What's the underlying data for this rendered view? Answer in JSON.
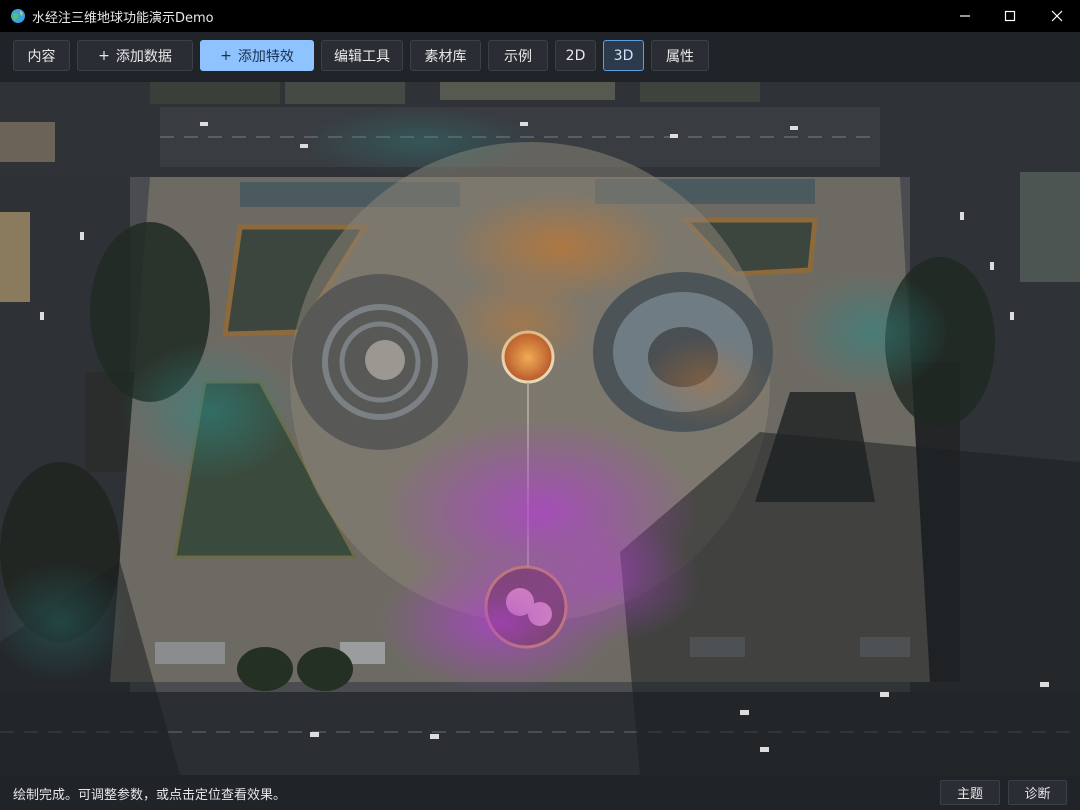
{
  "window": {
    "title": "水经注三维地球功能演示Demo",
    "controls": {
      "minimize": "—",
      "maximize": "☐",
      "close": "✕"
    }
  },
  "toolbar": {
    "content": "内容",
    "add_data": "添加数据",
    "add_effect": "添加特效",
    "edit_tools": "编辑工具",
    "material_library": "素材库",
    "examples": "示例",
    "view_2d": "2D",
    "view_3d": "3D",
    "properties": "属性",
    "plus_symbol": "+"
  },
  "status": {
    "message": "绘制完成。可调整参数，或点击定位查看效果。",
    "theme_button": "主题",
    "diagnose_button": "诊断"
  },
  "colors": {
    "accent_blue": "#8fc3ff",
    "active_3d_border": "#5f9de0",
    "heatmap_purple": "#b23fd1",
    "heatmap_orange": "#c8772b",
    "heatmap_teal": "#2c8a86"
  },
  "icons": {
    "app": "globe-icon",
    "minimize": "minimize-icon",
    "maximize": "maximize-icon",
    "close": "close-icon"
  }
}
